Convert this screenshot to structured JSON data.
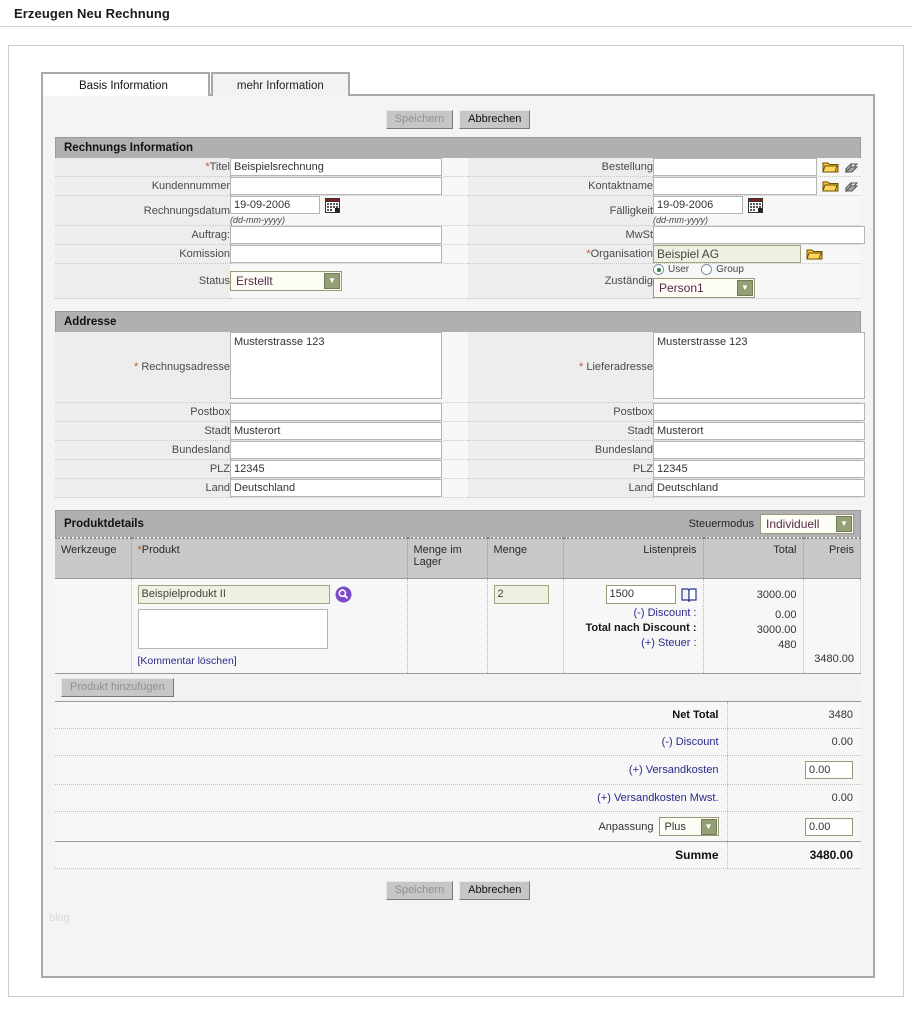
{
  "page": {
    "title": "Erzeugen Neu Rechnung",
    "watermark": "blog"
  },
  "tabs": [
    {
      "label": "Basis Information",
      "active": true
    },
    {
      "label": "mehr Information",
      "active": false
    }
  ],
  "buttons": {
    "save": "Speichern",
    "cancel": "Abbrechen",
    "add_product": "Produkt hinzufügen"
  },
  "sections": {
    "invoice_info": {
      "title": "Rechnungs Information"
    },
    "address": {
      "title": "Addresse"
    },
    "product_details": {
      "title": "Produktdetails"
    }
  },
  "invoice_info": {
    "left": [
      {
        "label": "Titel",
        "required": true,
        "type": "text",
        "value": "Beispielsrechnung"
      },
      {
        "label": "Kundennummer",
        "required": false,
        "type": "text",
        "value": ""
      },
      {
        "label": "Rechnungsdatum",
        "required": false,
        "type": "date",
        "value": "19-09-2006",
        "hint": "(dd-mm-yyyy)"
      },
      {
        "label": "Auftrag:",
        "required": false,
        "type": "text",
        "value": ""
      },
      {
        "label": "Komission",
        "required": false,
        "type": "text",
        "value": ""
      },
      {
        "label": "Status",
        "required": false,
        "type": "select",
        "value": "Erstellt"
      }
    ],
    "right": [
      {
        "label": "Bestellung",
        "required": false,
        "type": "lookup",
        "value": ""
      },
      {
        "label": "Kontaktname",
        "required": false,
        "type": "lookup",
        "value": ""
      },
      {
        "label": "Fälligkeit",
        "required": false,
        "type": "date",
        "value": "19-09-2006",
        "hint": "(dd-mm-yyyy)"
      },
      {
        "label": "MwSt",
        "required": false,
        "type": "text",
        "value": ""
      },
      {
        "label": "Organisation",
        "required": true,
        "type": "lookup-highlight",
        "value": "Beispiel AG"
      },
      {
        "label": "Zuständig",
        "required": false,
        "type": "assign",
        "value": "Person1",
        "radio": [
          {
            "label": "User",
            "selected": true
          },
          {
            "label": "Group",
            "selected": false
          }
        ]
      }
    ]
  },
  "address": {
    "left": [
      {
        "label": "Rechnugsadresse",
        "required": true,
        "type": "textarea",
        "value": "Musterstrasse 123"
      },
      {
        "label": "Postbox",
        "required": false,
        "type": "text",
        "value": ""
      },
      {
        "label": "Stadt",
        "required": false,
        "type": "text",
        "value": "Musterort"
      },
      {
        "label": "Bundesland",
        "required": false,
        "type": "text",
        "value": ""
      },
      {
        "label": "PLZ",
        "required": false,
        "type": "text",
        "value": "12345"
      },
      {
        "label": "Land",
        "required": false,
        "type": "text",
        "value": "Deutschland"
      }
    ],
    "right": [
      {
        "label": "Lieferadresse",
        "required": true,
        "type": "textarea",
        "value": "Musterstrasse 123"
      },
      {
        "label": "Postbox",
        "required": false,
        "type": "text",
        "value": ""
      },
      {
        "label": "Stadt",
        "required": false,
        "type": "text",
        "value": "Musterort"
      },
      {
        "label": "Bundesland",
        "required": false,
        "type": "text",
        "value": ""
      },
      {
        "label": "PLZ",
        "required": false,
        "type": "text",
        "value": "12345"
      },
      {
        "label": "Land",
        "required": false,
        "type": "text",
        "value": "Deutschland"
      }
    ]
  },
  "product_details": {
    "tax_mode_label": "Steuermodus",
    "tax_mode_value": "Individuell",
    "columns": [
      "Werkzeuge",
      "Produkt",
      "Menge im Lager",
      "Menge",
      "Listenpreis",
      "Total",
      "Preis"
    ],
    "product_column_required": true,
    "row": {
      "product_name": "Beispielprodukt II",
      "comment": "",
      "delete_comment_link": "[Kommentar löschen]",
      "stock_qty": "",
      "qty": "2",
      "list_price": "1500",
      "total": "3000.00",
      "discount_label": "(-) Discount :",
      "discount_value": "0.00",
      "total_after_discount_label": "Total nach Discount :",
      "total_after_discount_value": "3000.00",
      "tax_label": "(+) Steuer :",
      "tax_value": "480",
      "price": "3480.00"
    },
    "totals": [
      {
        "label": "Net Total",
        "value": "3480",
        "bold": true,
        "input": false,
        "select": null
      },
      {
        "label": "(-) Discount",
        "value": "0.00",
        "bold": false,
        "input": false,
        "select": null
      },
      {
        "label": "(+) Versandkosten",
        "value": "0.00",
        "bold": false,
        "input": true,
        "select": null
      },
      {
        "label": "(+) Versandkosten Mwst.",
        "value": "0.00",
        "bold": false,
        "input": false,
        "select": null
      },
      {
        "label": "Anpassung",
        "value": "0.00",
        "bold": false,
        "input": true,
        "select": "Plus"
      },
      {
        "label": "Summe",
        "value": "3480.00",
        "bold": true,
        "input": false,
        "select": null
      }
    ]
  }
}
